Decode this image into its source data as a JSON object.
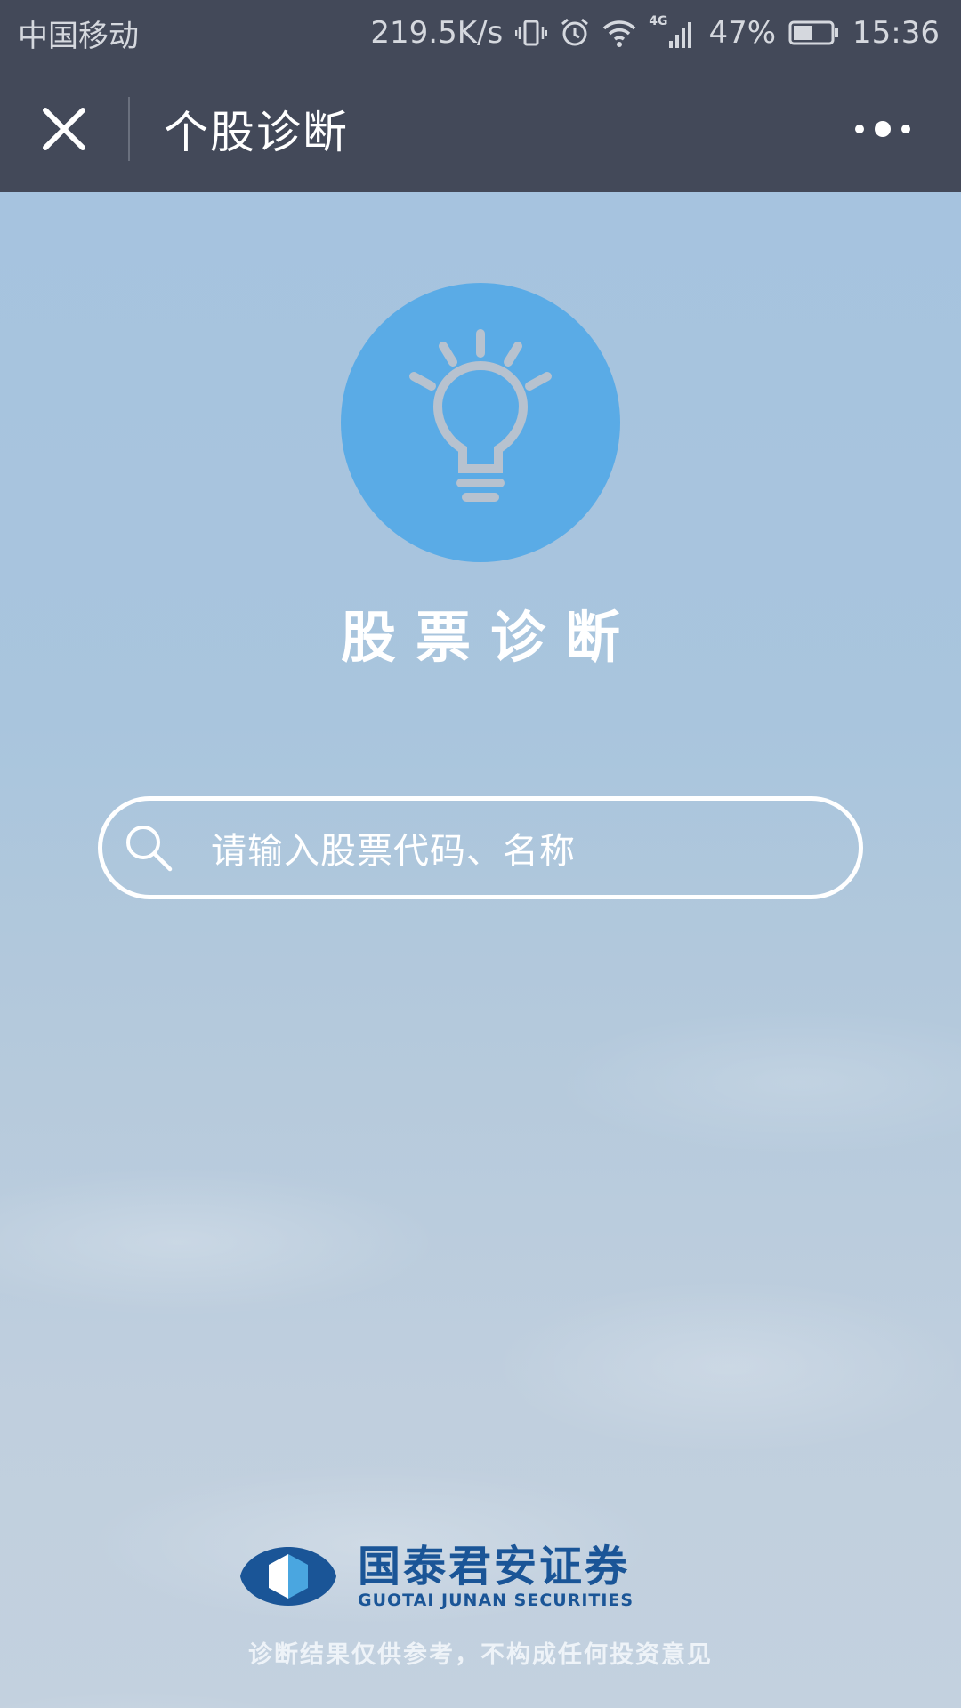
{
  "status_bar": {
    "carrier": "中国移动",
    "speed": "219.5K/s",
    "network": "4G",
    "battery": "47%",
    "time": "15:36",
    "icons": [
      "vibrate-icon",
      "alarm-icon",
      "wifi-icon",
      "signal-icon",
      "battery-icon"
    ]
  },
  "nav": {
    "title": "个股诊断",
    "close_icon": "close-icon",
    "more_icon": "more-icon"
  },
  "hero": {
    "icon": "lightbulb-icon",
    "title": "股票诊断",
    "circle_color": "#5aabe6"
  },
  "search": {
    "placeholder": "请输入股票代码、名称"
  },
  "brand": {
    "name_cn": "国泰君安证券",
    "name_en": "GUOTAI JUNAN SECURITIES",
    "color": "#1a5597"
  },
  "disclaimer": "诊断结果仅供参考，不构成任何投资意见"
}
